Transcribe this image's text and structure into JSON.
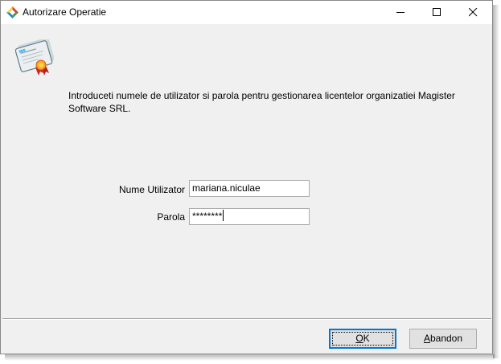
{
  "window": {
    "title": "Autorizare Operatie",
    "controls": {
      "minimize_icon": "minimize-icon",
      "maximize_icon": "maximize-icon",
      "close_icon": "close-icon"
    }
  },
  "dialog": {
    "icon": "certificate-icon",
    "message": "Introduceti numele de utilizator si parola pentru gestionarea licentelor organizatiei Magister Software SRL.",
    "fields": {
      "username": {
        "label": "Nume Utilizator",
        "value": "mariana.niculae"
      },
      "password": {
        "label": "Parola",
        "value": "********"
      }
    }
  },
  "buttons": {
    "ok": {
      "mnemonic": "O",
      "rest": "K"
    },
    "abandon": {
      "mnemonic": "A",
      "rest": "bandon"
    }
  },
  "colors": {
    "window_bg": "#f0f0f0",
    "titlebar_bg": "#ffffff",
    "focus_border": "#0078d7",
    "button_bg": "#e1e1e1"
  }
}
